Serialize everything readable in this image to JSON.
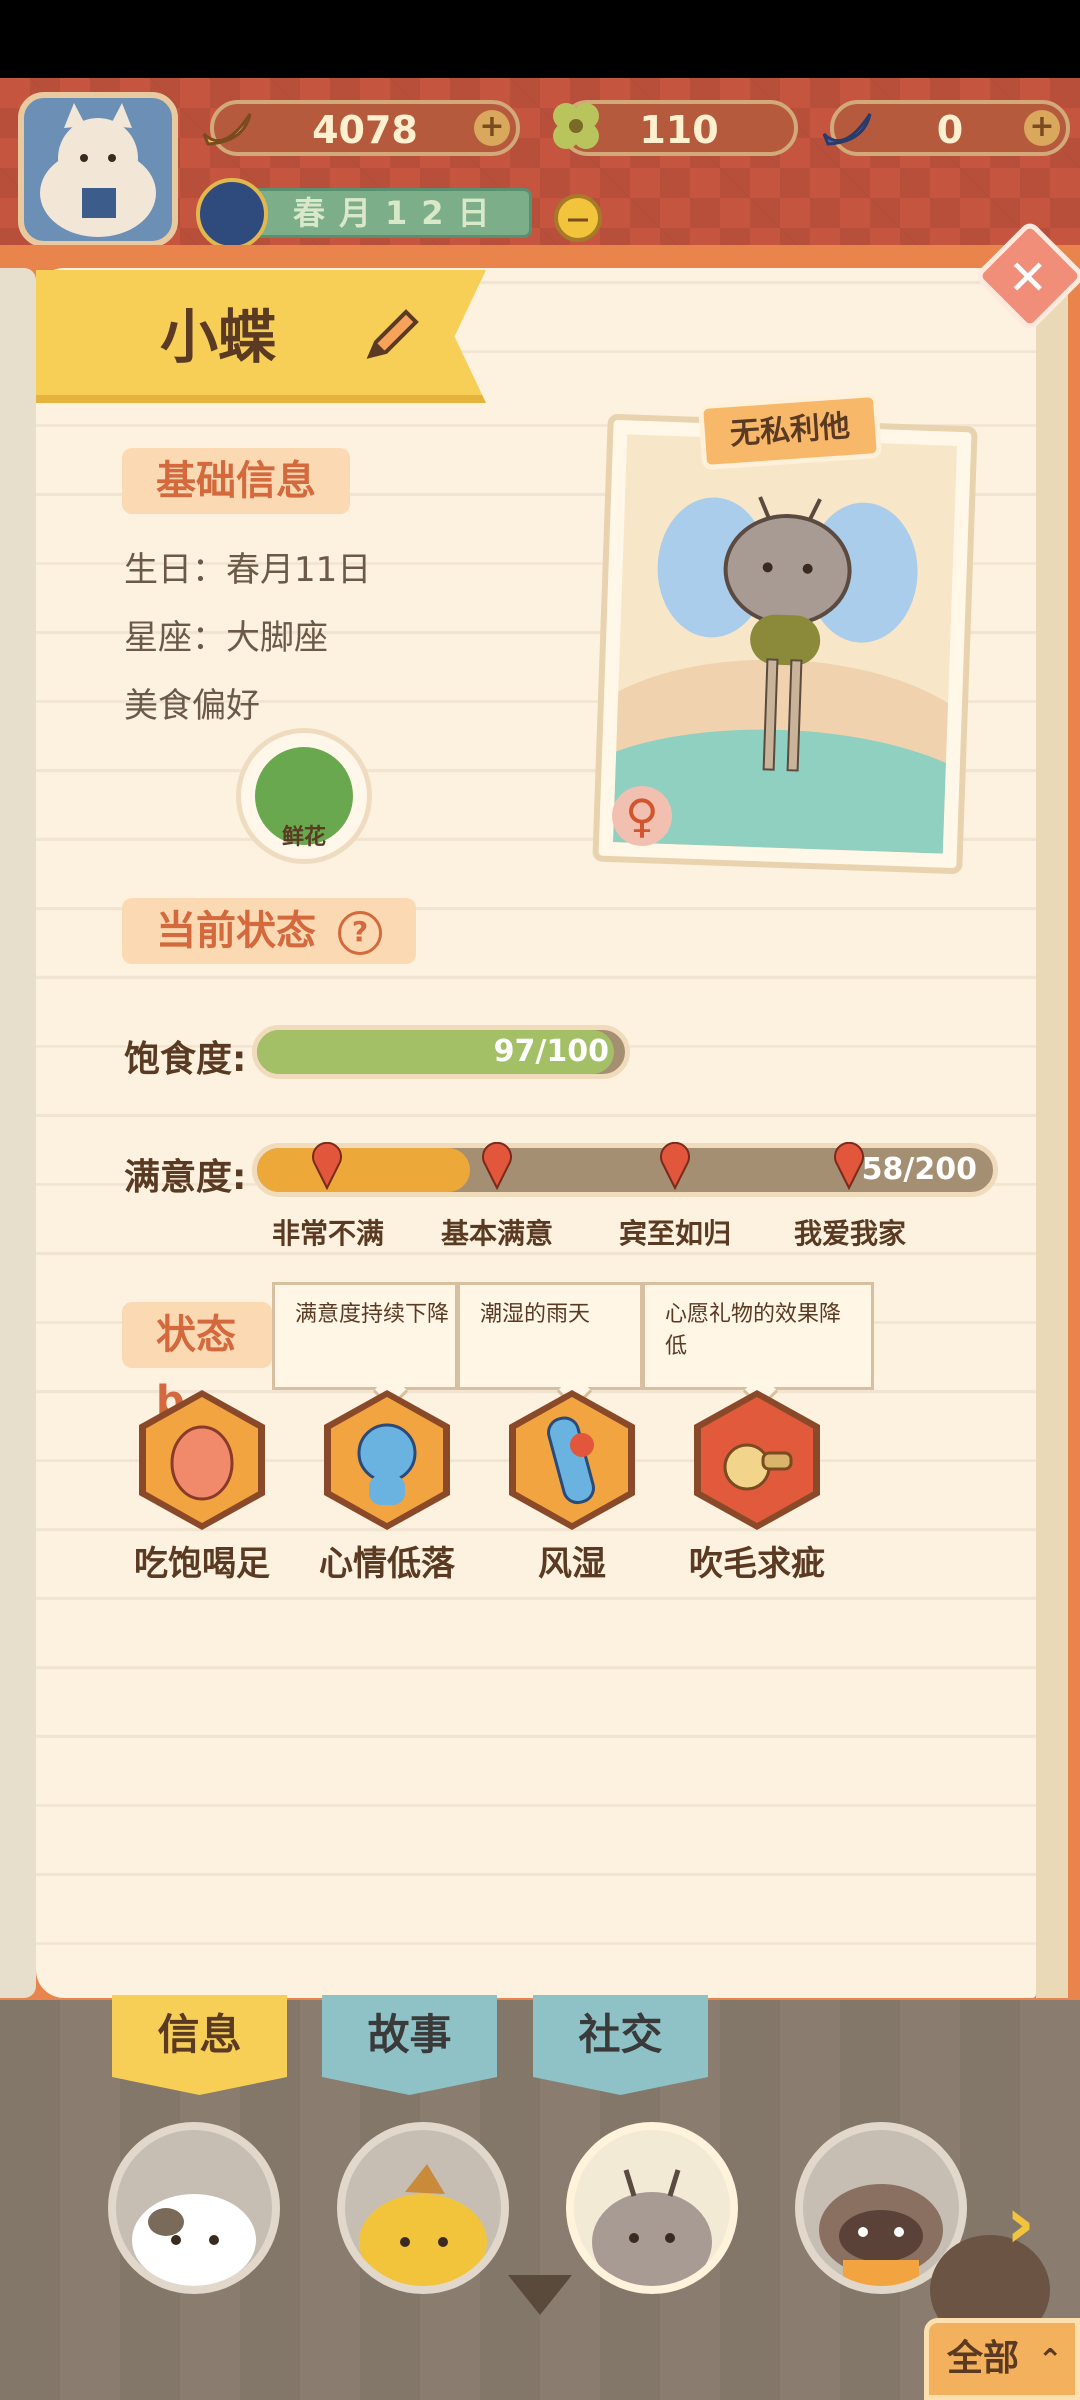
{
  "header": {
    "bananas": "4078",
    "clovers": "110",
    "blue_bananas": "0",
    "plus": "+",
    "date": "春月12日"
  },
  "character": {
    "name": "小蝶",
    "trait": "无私利他",
    "gender_symbol": "♀"
  },
  "basic_info": {
    "title": "基础信息",
    "birthday": "生日：春月11日",
    "sign": "星座：大脚座",
    "food_pref": "美食偏好",
    "food_item": "鲜花"
  },
  "status": {
    "title": "当前状态",
    "help": "?",
    "satiety_label": "饱食度:",
    "satiety_text": "97/100",
    "satiety_fraction": 0.97,
    "satisfaction_label": "满意度:",
    "satisfaction_text": "58/200",
    "satisfaction_fraction": 0.29,
    "levels": [
      "非常不满",
      "基本满意",
      "宾至如归",
      "我爱我家"
    ]
  },
  "buffs": {
    "title": "状态b",
    "tooltips": [
      "满意度持续下降",
      "潮湿的雨天",
      "心愿礼物的效果降低"
    ],
    "effects": [
      "吃饱喝足",
      "心情低落",
      "风湿",
      "吹毛求疵"
    ]
  },
  "tabs": {
    "info": "信息",
    "story": "故事",
    "social": "社交"
  },
  "bottom": {
    "all_label": "全部",
    "next": "›"
  },
  "colors": {
    "satiety_fill": "#a4c066",
    "satisfaction_fill": "#eda83a",
    "banner": "#f7cf57",
    "accent": "#d3693c"
  }
}
